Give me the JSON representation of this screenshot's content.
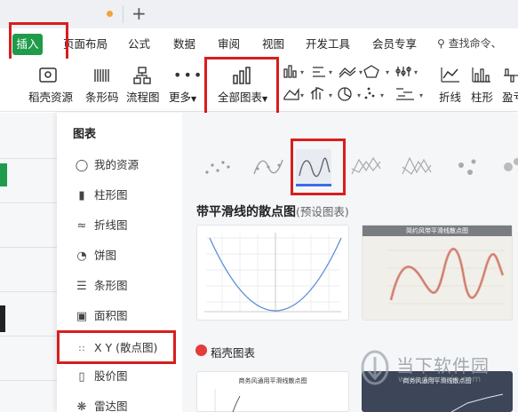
{
  "menu": {
    "items": [
      "插入",
      "页面布局",
      "公式",
      "数据",
      "审阅",
      "视图",
      "开发工具",
      "会员专享"
    ],
    "search_placeholder": "查找命令、"
  },
  "ribbon": {
    "buttons": [
      "稻壳资源",
      "条形码",
      "流程图",
      "更多",
      "全部图表",
      "折线",
      "柱形",
      "盈亏"
    ]
  },
  "dialog": {
    "sidebar_title": "图表",
    "sidebar_items": [
      "我的资源",
      "柱形图",
      "折线图",
      "饼图",
      "条形图",
      "面积图",
      "X Y (散点图)",
      "股价图",
      "雷达图"
    ],
    "section_title": "带平滑线的散点图",
    "section_sub": "(预设图表)",
    "card2_title": "简约风带平滑线散点图",
    "card3_title": "商务风通用平滑线散点图",
    "card4_title": "商务风通用平滑线散点图",
    "daoke_title": "稻壳图表"
  },
  "watermark": {
    "line1": "当下软件园",
    "line2": "www.downxia.com"
  },
  "colors": {
    "accent_green": "#1f9b4a",
    "highlight_red": "#d81e1e",
    "selected_blue": "#3a6ee8"
  }
}
